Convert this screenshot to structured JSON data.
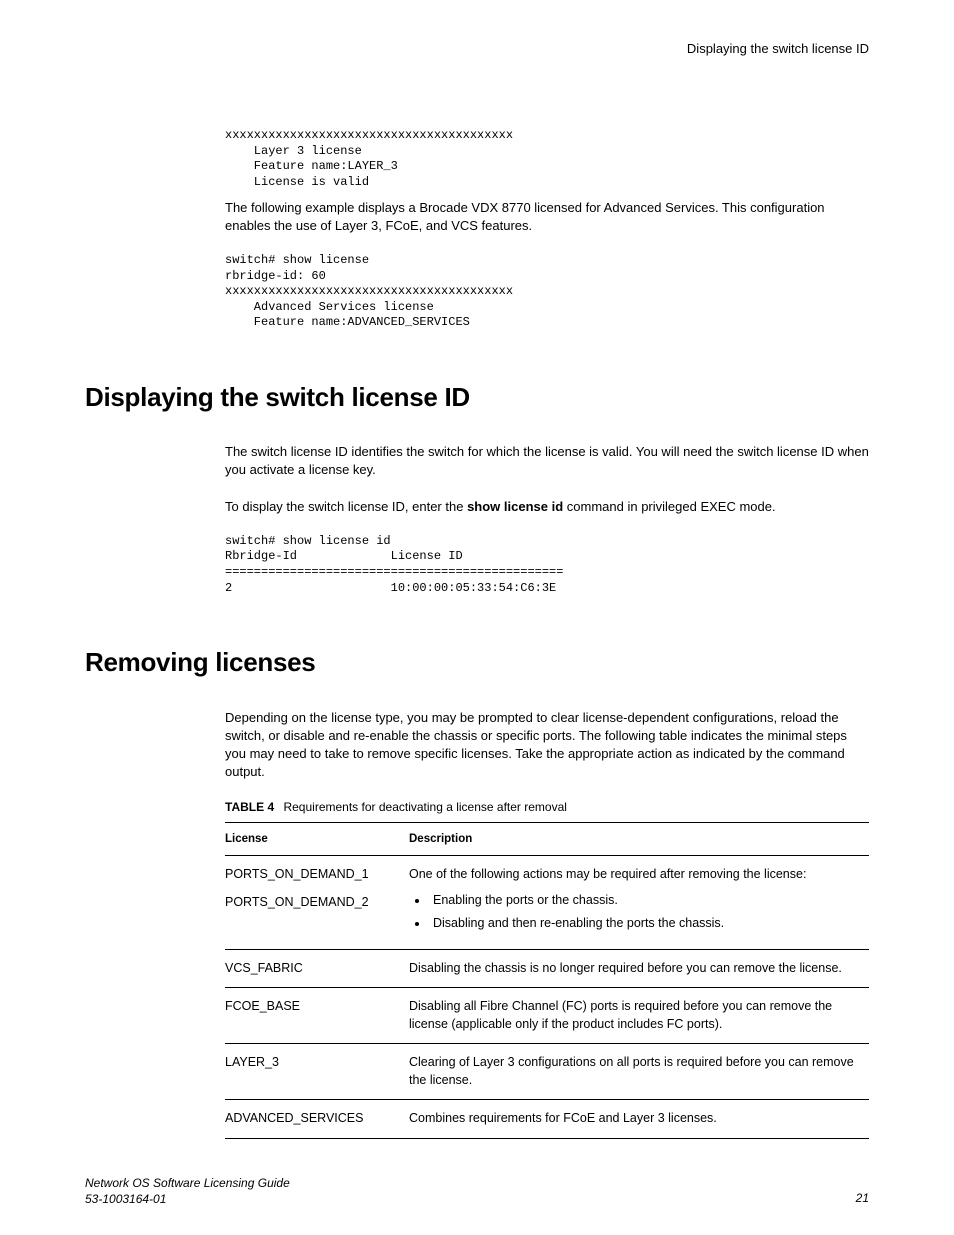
{
  "header": {
    "title": "Displaying the switch license ID"
  },
  "code1": "xxxxxxxxxxxxxxxxxxxxxxxxxxxxxxxxxxxxxxxx\n    Layer 3 license\n    Feature name:LAYER_3\n    License is valid",
  "para1": "The following example displays a Brocade VDX 8770 licensed for Advanced Services. This configuration enables the use of Layer 3, FCoE, and VCS features.",
  "code2": "switch# show license\nrbridge-id: 60\nxxxxxxxxxxxxxxxxxxxxxxxxxxxxxxxxxxxxxxxx\n    Advanced Services license\n    Feature name:ADVANCED_SERVICES",
  "h1a": "Displaying the switch license ID",
  "para2": "The switch license ID identifies the switch for which the license is valid. You will need the switch license ID when you activate a license key.",
  "para3_pre": "To display the switch license ID, enter the ",
  "para3_cmd": "show license id",
  "para3_post": " command in privileged EXEC mode.",
  "code3": "switch# show license id\nRbridge-Id             License ID\n===============================================\n2                      10:00:00:05:33:54:C6:3E",
  "h1b": "Removing licenses",
  "para4": "Depending on the license type, you may be prompted to clear license-dependent configurations, reload the switch, or disable and re-enable the chassis or specific ports. The following table indicates the minimal steps you may need to take to remove specific licenses. Take the appropriate action as indicated by the command output.",
  "table": {
    "label": "TABLE 4",
    "caption": "Requirements for deactivating a license after removal",
    "head_license": "License",
    "head_desc": "Description",
    "row1_lic1": "PORTS_ON_DEMAND_1",
    "row1_lic2": "PORTS_ON_DEMAND_2",
    "row1_desc": "One of the following actions may be required after removing the license:",
    "row1_b1": "Enabling the ports or the chassis.",
    "row1_b2": "Disabling and then re-enabling the ports the chassis.",
    "row2_lic": "VCS_FABRIC",
    "row2_desc": "Disabling the chassis is no longer required before you can remove the license.",
    "row3_lic": "FCOE_BASE",
    "row3_desc": "Disabling all Fibre Channel (FC) ports is required before you can remove the license (applicable only if the product includes FC ports).",
    "row4_lic": "LAYER_3",
    "row4_desc": "Clearing of Layer 3 configurations on all ports is required before you can remove the license.",
    "row5_lic": "ADVANCED_SERVICES",
    "row5_desc": "Combines requirements for FCoE and Layer 3 licenses."
  },
  "footer": {
    "title": "Network OS Software Licensing Guide",
    "docnum": "53-1003164-01",
    "page": "21"
  }
}
